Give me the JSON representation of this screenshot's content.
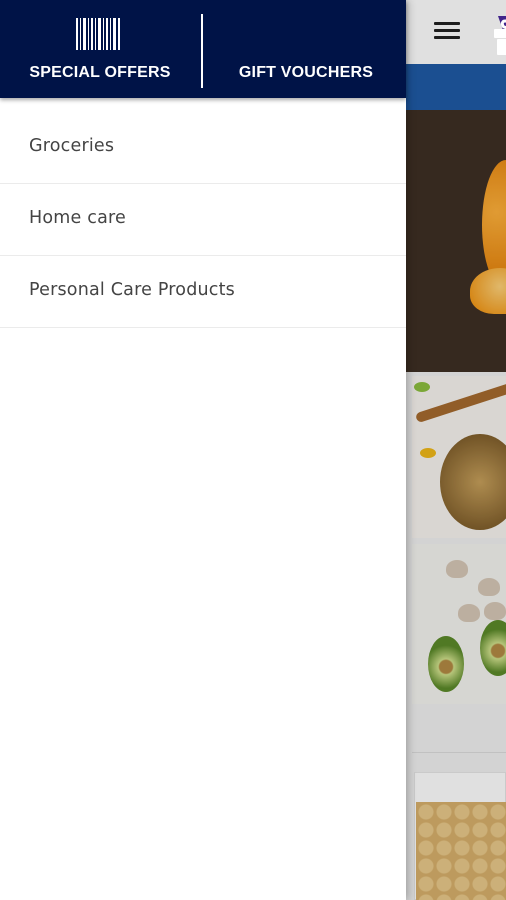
{
  "drawer": {
    "header": {
      "special_offers": {
        "label": "SPECIAL OFFERS",
        "icon": "barcode-icon"
      },
      "gift_vouchers": {
        "label": "GIFT VOUCHERS",
        "icon": "gift-icon"
      },
      "background_color": "#001347"
    },
    "menu_items": [
      {
        "label": "Groceries"
      },
      {
        "label": "Home care"
      },
      {
        "label": "Personal Care Products"
      }
    ]
  },
  "background_app": {
    "menu_icon": "hamburger-menu-icon",
    "accent_bar_color": "#1f5aa6"
  }
}
